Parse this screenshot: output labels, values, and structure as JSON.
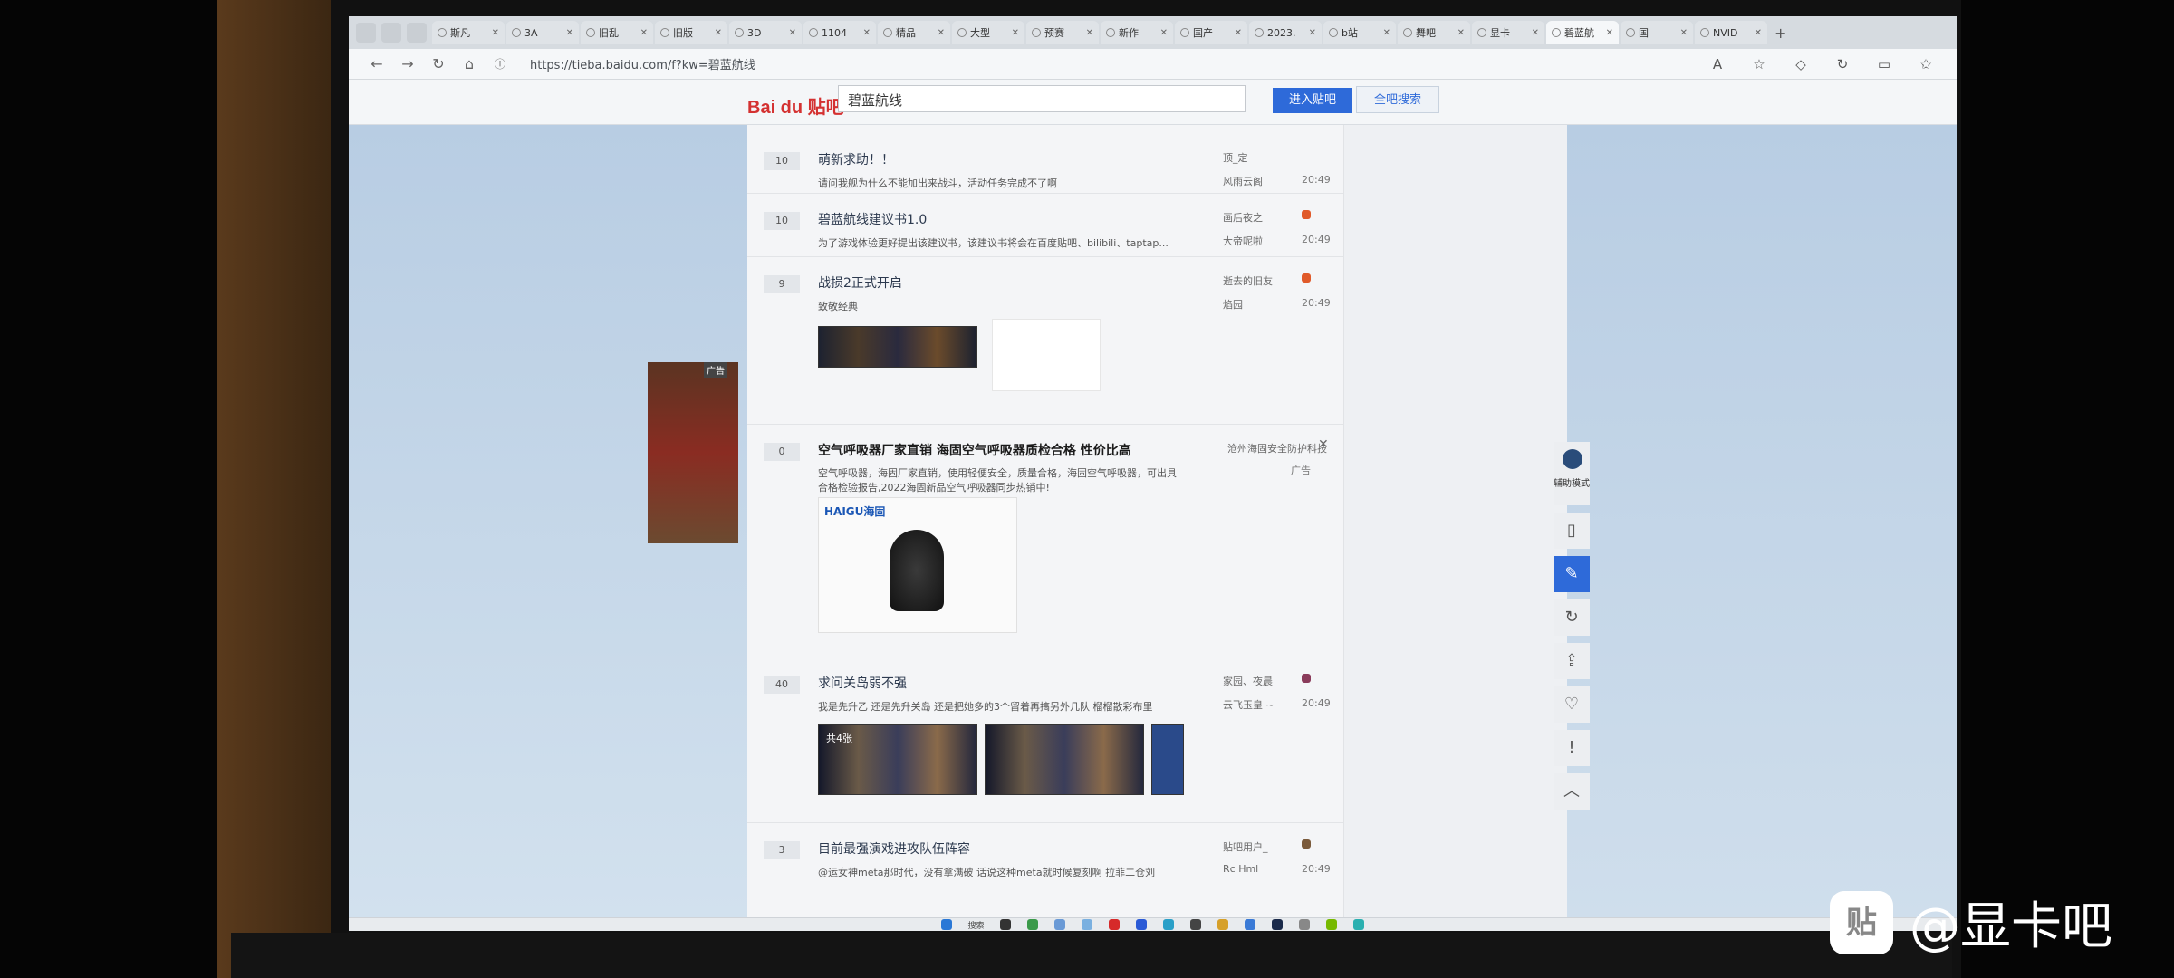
{
  "browser": {
    "tabs": [
      "斯凡",
      "3A",
      "旧乱",
      "旧版",
      "3D",
      "1104",
      "精品",
      "大型",
      "预赛",
      "新作",
      "国产",
      "2023.",
      "b站",
      "舞吧",
      "显卡",
      "碧蓝航",
      "国",
      "NVID"
    ],
    "active_tab_index": 15,
    "url": "https://tieba.baidu.com/f?kw=碧蓝航线"
  },
  "header": {
    "logo": "Bai du 贴吧",
    "search_value": "碧蓝航线",
    "enter_button": "进入贴吧",
    "all_search_button": "全吧搜索"
  },
  "threads": [
    {
      "replies": "10",
      "title": "萌新求助！！",
      "abstract": "请问我舰为什么不能加出来战斗，活动任务完成不了啊",
      "author": "顶_定",
      "last_reply": "风雨云阁",
      "time": "20:49"
    },
    {
      "replies": "10",
      "title": "碧蓝航线建议书1.0",
      "abstract": "为了游戏体验更好提出该建议书，该建议书将会在百度贴吧、bilibili、taptap...",
      "author": "画后夜之",
      "last_reply": "大帝呢啦",
      "time": "20:49"
    },
    {
      "replies": "9",
      "title": "战损2正式开启",
      "abstract": "致敬经典",
      "author": "逝去的旧友",
      "last_reply": "焰园",
      "time": "20:49"
    },
    {
      "replies": "40",
      "title": "求问关岛弱不强",
      "abstract": "我是先升乙 还是先升关岛 还是把她多的3个留着再搞另外几队 榴榴散彩布里",
      "author": "家园、夜晨",
      "last_reply": "云飞玉皇 ~",
      "time": "20:49",
      "image_caption": "共4张"
    },
    {
      "replies": "3",
      "title": "目前最强演戏进攻队伍阵容",
      "abstract": "@运女神meta那时代，没有拿满破 话说这种meta就时候复刻啊 拉菲二仓刘",
      "author": "贴吧用户_",
      "last_reply": "Rc Hml",
      "time": "20:49"
    }
  ],
  "ad": {
    "replies": "0",
    "title": "空气呼吸器厂家直销 海固空气呼吸器质检合格 性价比高",
    "abstract": "空气呼吸器，海固厂家直销，使用轻便安全，质量合格，海固空气呼吸器，可出具合格检验报告,2022海固新品空气呼吸器同步热销中!",
    "author": "沧州海固安全防护科技",
    "ad_label": "广告",
    "close": "✕",
    "brand": "HAIGU海固",
    "banner_tag": "广告"
  },
  "tools": {
    "assist_label": "辅助模式",
    "icons": [
      "phone-icon",
      "edit-icon",
      "refresh-icon",
      "share-icon",
      "heart-icon",
      "report-icon",
      "back-to-top-icon"
    ]
  },
  "taskbar": {
    "search": "搜索"
  },
  "watermark": {
    "logo": "贴",
    "text": "@显卡吧"
  }
}
